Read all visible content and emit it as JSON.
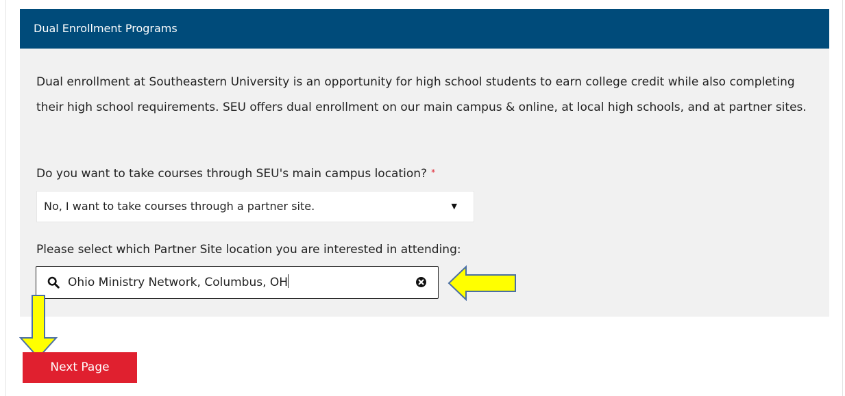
{
  "panel": {
    "title": "Dual Enrollment Programs",
    "header_color": "#004b7a",
    "body_color": "#f1f1f1"
  },
  "intro": {
    "text": "Dual enrollment at Southeastern University is an opportunity for high school students to earn college credit while also completing their high school requirements. SEU offers dual enrollment on our main campus & online, at local high schools, and at partner sites."
  },
  "campus_question": {
    "label": "Do you want to take courses through SEU's main campus location?",
    "required_marker": "*",
    "selected_value": "No, I want to take courses through a partner site.",
    "caret_icon": "caret-down-icon"
  },
  "partner_site": {
    "label": "Please select which Partner Site location you are interested in attending:",
    "value": "Ohio Ministry Network, Columbus, OH",
    "search_icon": "search-icon",
    "clear_icon": "clear-circle-x-icon"
  },
  "annotations": {
    "arrow_color": "#ffff00",
    "arrow_outline": "#4a6fa5",
    "arrows": [
      "left-pointing-arrow",
      "down-pointing-arrow"
    ]
  },
  "navigation": {
    "next_label": "Next Page",
    "next_color": "#e0202f"
  }
}
